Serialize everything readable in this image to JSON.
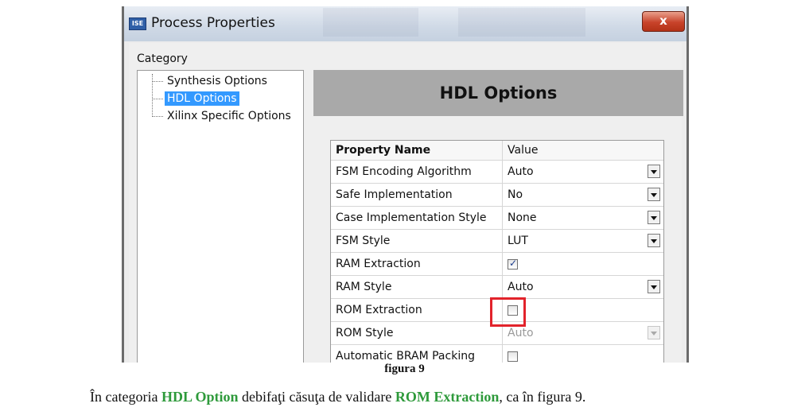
{
  "window": {
    "app_icon": "ISE",
    "title": "Process Properties",
    "close_glyph": "x"
  },
  "category": {
    "label": "Category",
    "items": [
      {
        "label": "Synthesis Options",
        "selected": false
      },
      {
        "label": "HDL Options",
        "selected": true
      },
      {
        "label": "Xilinx Specific Options",
        "selected": false
      }
    ]
  },
  "panel": {
    "title": "HDL Options"
  },
  "properties": {
    "columns": [
      "Property Name",
      "Value"
    ],
    "rows": [
      {
        "name": "FSM Encoding Algorithm",
        "type": "combo",
        "value": "Auto"
      },
      {
        "name": "Safe Implementation",
        "type": "combo",
        "value": "No"
      },
      {
        "name": "Case Implementation Style",
        "type": "combo",
        "value": "None"
      },
      {
        "name": "FSM Style",
        "type": "combo",
        "value": "LUT"
      },
      {
        "name": "RAM Extraction",
        "type": "checkbox",
        "checked": true
      },
      {
        "name": "RAM Style",
        "type": "combo",
        "value": "Auto"
      },
      {
        "name": "ROM Extraction",
        "type": "checkbox",
        "checked": false
      },
      {
        "name": "ROM Style",
        "type": "combo-disabled",
        "value": "Auto"
      },
      {
        "name": "Automatic BRAM Packing",
        "type": "checkbox",
        "checked": false
      }
    ]
  },
  "caption": "figura 9",
  "instruction": {
    "before": "În categoria ",
    "hl1": "HDL Option",
    "middle": " debifaţi căsuţa de validare ",
    "hl2": "ROM Extraction",
    "after": ", ca în figura 9."
  },
  "colors": {
    "highlight_box": "#e2232b",
    "green_text": "#2e9a3b",
    "selection": "#3399ff"
  }
}
